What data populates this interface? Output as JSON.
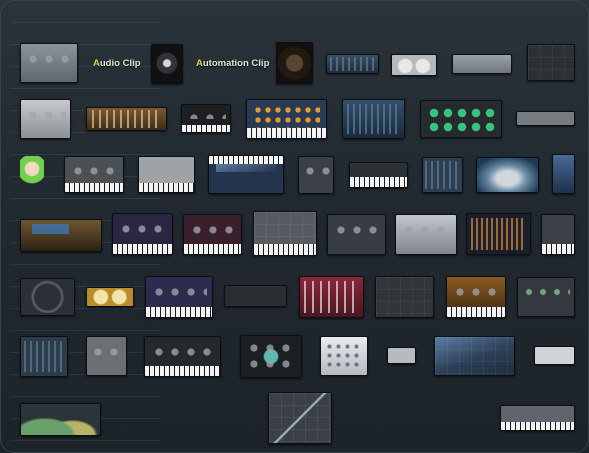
{
  "labels": {
    "audio_clip_first": "A",
    "audio_clip_rest": "udio Clip",
    "automation_clip_first": "A",
    "automation_clip_rest": "utomation Clip"
  },
  "colors": {
    "background": "#222a31",
    "label_text": "#e4e4d2",
    "label_highlight": "#e6d24a"
  },
  "plugins": [
    {
      "row": 1,
      "kind": "gray-knob-panel"
    },
    {
      "row": 1,
      "kind": "audio-clip-icon"
    },
    {
      "row": 1,
      "kind": "automation-clip-icon"
    },
    {
      "row": 1,
      "kind": "dark-blue-strip"
    },
    {
      "row": 1,
      "kind": "white-knob-module"
    },
    {
      "row": 1,
      "kind": "gray-strip"
    },
    {
      "row": 1,
      "kind": "mixer-window"
    },
    {
      "row": 2,
      "kind": "gray-rack"
    },
    {
      "row": 2,
      "kind": "wood-bar-synth"
    },
    {
      "row": 2,
      "kind": "dark-keyboard-synth"
    },
    {
      "row": 2,
      "kind": "step-sequencer"
    },
    {
      "row": 2,
      "kind": "blue-vocoder"
    },
    {
      "row": 2,
      "kind": "drum-pads"
    },
    {
      "row": 2,
      "kind": "small-gray-strip"
    },
    {
      "row": 3,
      "kind": "mascot"
    },
    {
      "row": 3,
      "kind": "gray-synth-keys"
    },
    {
      "row": 3,
      "kind": "silver-synth-keys"
    },
    {
      "row": 3,
      "kind": "blue-eq-keys"
    },
    {
      "row": 3,
      "kind": "dark-knob-box"
    },
    {
      "row": 3,
      "kind": "keyboard-synth"
    },
    {
      "row": 3,
      "kind": "waveform-editor"
    },
    {
      "row": 3,
      "kind": "photo-visualizer"
    },
    {
      "row": 3,
      "kind": "narrow-blue-plugin"
    },
    {
      "row": 4,
      "kind": "gms-synth"
    },
    {
      "row": 4,
      "kind": "purple-synth-keys"
    },
    {
      "row": 4,
      "kind": "red-synth-keys"
    },
    {
      "row": 4,
      "kind": "gray-keys-panel"
    },
    {
      "row": 4,
      "kind": "knob-rack"
    },
    {
      "row": 4,
      "kind": "silver-knob-box"
    },
    {
      "row": 4,
      "kind": "spectrum-analyzer"
    },
    {
      "row": 4,
      "kind": "small-keys-synth"
    },
    {
      "row": 5,
      "kind": "circular-panner"
    },
    {
      "row": 5,
      "kind": "gold-knob-module"
    },
    {
      "row": 5,
      "kind": "purple-pad-synth"
    },
    {
      "row": 5,
      "kind": "dark-settings"
    },
    {
      "row": 5,
      "kind": "red-slider-synth"
    },
    {
      "row": 5,
      "kind": "oscilloscope"
    },
    {
      "row": 5,
      "kind": "orange-synth-keys"
    },
    {
      "row": 5,
      "kind": "green-knob-rack"
    },
    {
      "row": 6,
      "kind": "eq-band"
    },
    {
      "row": 6,
      "kind": "gray-sampler"
    },
    {
      "row": 6,
      "kind": "black-synth-keys"
    },
    {
      "row": 6,
      "kind": "grid-synth"
    },
    {
      "row": 6,
      "kind": "white-drum-machine"
    },
    {
      "row": 6,
      "kind": "small-white-strip"
    },
    {
      "row": 6,
      "kind": "envelope-editor"
    },
    {
      "row": 6,
      "kind": "gray-small-panel"
    },
    {
      "row": 7,
      "kind": "eq-curves"
    },
    {
      "row": 7,
      "kind": "automation-graph"
    },
    {
      "row": 7,
      "kind": "keys-panel-small"
    }
  ]
}
